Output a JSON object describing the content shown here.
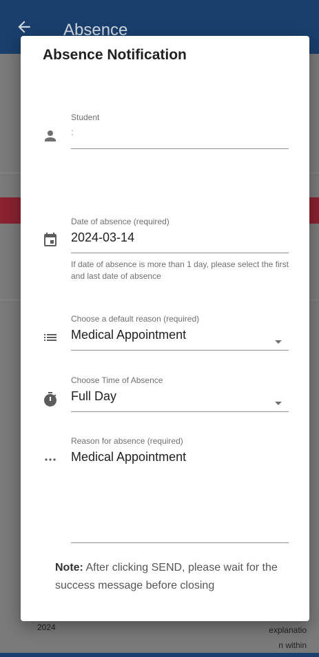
{
  "app": {
    "title": "Absence",
    "background_left_text": "2024",
    "background_right_text": "explanatio\nn within"
  },
  "dialog": {
    "title": "Absence Notification",
    "student": {
      "label": "Student",
      "value": ":"
    },
    "date": {
      "label": "Date of absence (required)",
      "value": "2024-03-14",
      "hint": "If date of absence is more than 1 day, please select the first and last date of absence"
    },
    "default_reason": {
      "label": "Choose a default reason (required)",
      "value": "Medical Appointment"
    },
    "time": {
      "label": "Choose Time of Absence",
      "value": "Full Day"
    },
    "reason": {
      "label": "Reason for absence (required)",
      "value": "Medical Appointment"
    },
    "note_label": "Note:",
    "note_text": " After clicking SEND, please wait for the success message before closing"
  },
  "colors": {
    "appbar": "#1a3f6c",
    "accent_red": "#8a2230"
  },
  "icons": [
    "back-arrow-icon",
    "person-icon",
    "calendar-icon",
    "list-icon",
    "timer-icon",
    "more-horiz-icon"
  ]
}
